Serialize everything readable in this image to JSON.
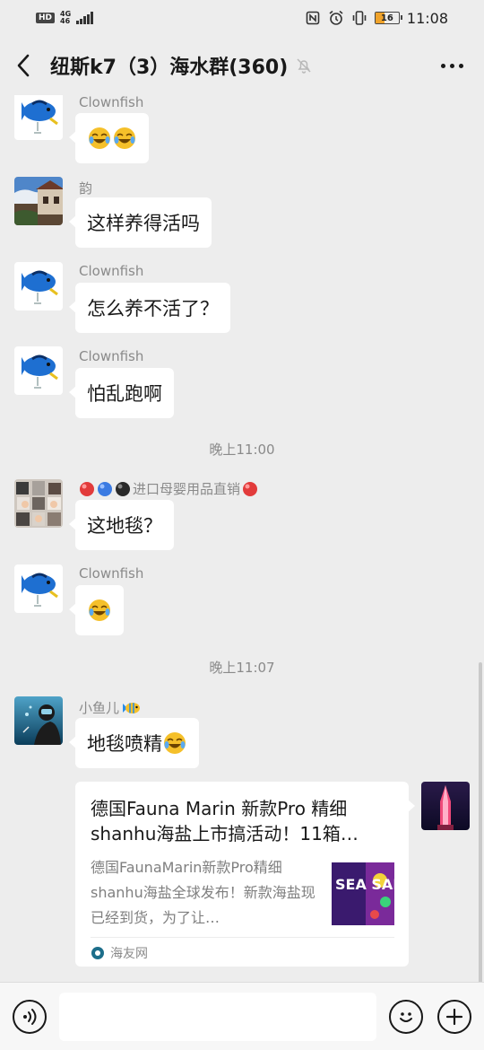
{
  "status_bar": {
    "hd": "HD",
    "network_top": "4G",
    "network_bottom": "46",
    "battery": "16",
    "time": "11:08"
  },
  "header": {
    "title": "纽斯k7（3）海水群(360)"
  },
  "messages": [
    {
      "sender": "Clownfish",
      "text": ""
    },
    {
      "sender": "韵",
      "text": "这样养得活吗"
    },
    {
      "sender": "Clownfish",
      "text": "怎么养不活了？"
    },
    {
      "sender": "Clownfish",
      "text": "怕乱跑啊"
    },
    {
      "sender_suffix": "进口母婴用品直销",
      "text": "这地毯？"
    },
    {
      "sender": "Clownfish",
      "text": ""
    },
    {
      "sender": "小鱼儿",
      "text": "地毯喷精"
    }
  ],
  "timestamps": [
    "晚上11:00",
    "晚上11:07"
  ],
  "link_card": {
    "title": "德国Fauna Marin 新款Pro 精细shanhu海盐上市搞活动！11箱…",
    "description": "德国FaunaMarin新款Pro精细shanhu海盐全球发布！新款海盐现已经到货，为了让…",
    "source": "海友网",
    "thumb_text": "SEA SALT"
  },
  "input": {
    "value": "",
    "placeholder": ""
  },
  "icons": {
    "back": "chevron-left-icon",
    "mute": "bell-off-icon",
    "more": "more-dots-icon",
    "voice": "voice-icon",
    "emoji": "smiley-icon",
    "plus": "plus-icon"
  }
}
